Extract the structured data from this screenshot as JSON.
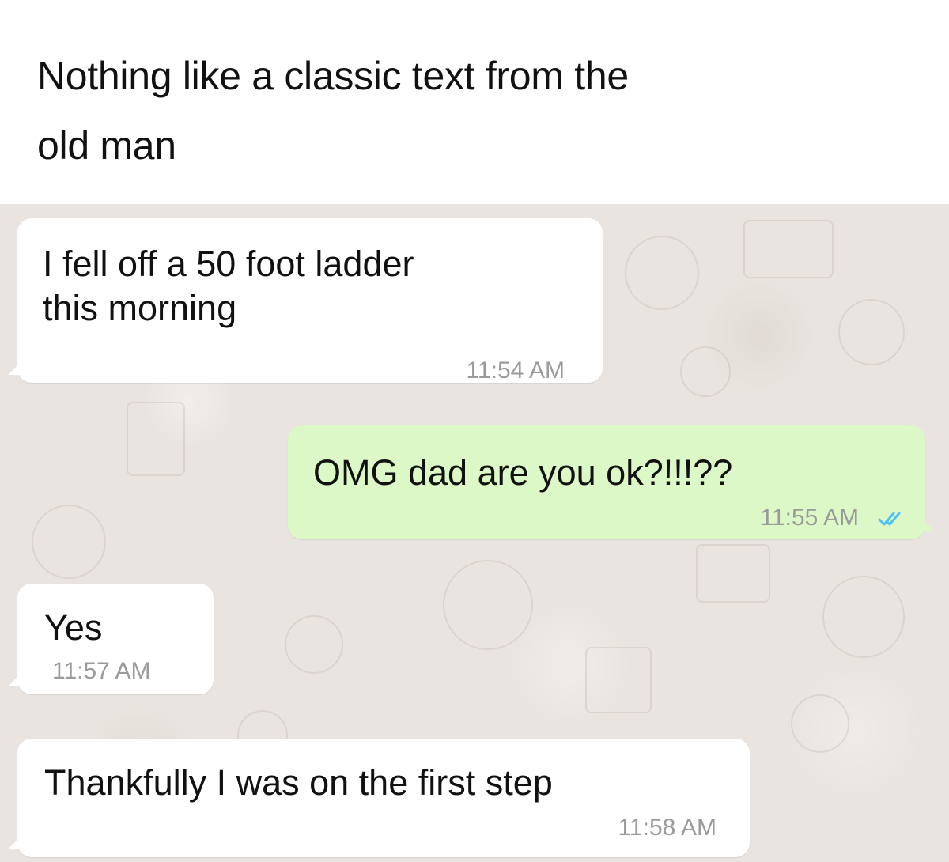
{
  "caption": "Nothing like a classic text from the\nold man",
  "messages": [
    {
      "direction": "incoming",
      "text": "I fell off a 50 foot ladder\nthis morning",
      "time": "11:54 AM"
    },
    {
      "direction": "outgoing",
      "text": "OMG dad are you ok?!!!??",
      "time": "11:55 AM",
      "status_icon": "double-check-icon",
      "status_color": "#4fc3f7"
    },
    {
      "direction": "incoming",
      "text": "Yes",
      "time": "11:57 AM"
    },
    {
      "direction": "incoming",
      "text": "Thankfully I was on the first step",
      "time": "11:58 AM"
    }
  ],
  "colors": {
    "incoming_bubble": "#ffffff",
    "outgoing_bubble": "#dcf8c6",
    "chat_background": "#e9e4df"
  }
}
